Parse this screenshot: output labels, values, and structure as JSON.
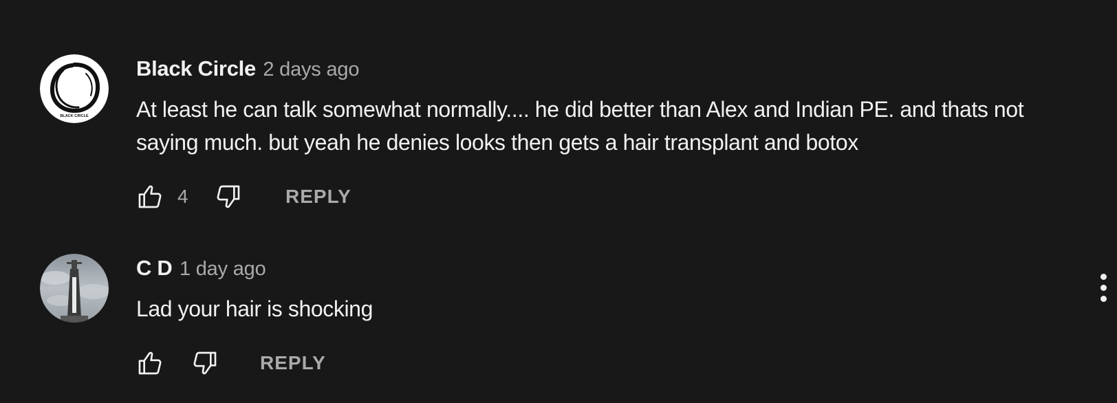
{
  "comments": [
    {
      "author": "Black Circle",
      "time": "2 days ago",
      "text": "At least he can talk somewhat normally.... he did better than Alex and Indian PE. and thats not saying much. but yeah he denies looks then gets a hair transplant and botox",
      "likes": "4",
      "reply_label": "REPLY",
      "avatar_caption": "BLACK CIRCLE",
      "avatar_icon": "ink-circle-logo"
    },
    {
      "author": "C D",
      "time": "1 day ago",
      "text": "Lad your hair is shocking",
      "likes": "",
      "reply_label": "REPLY",
      "avatar_icon": "monument-photo"
    }
  ],
  "colors": {
    "background": "#181818",
    "primary_text": "#f1f1f1",
    "secondary_text": "#aaaaaa"
  },
  "icons": {
    "like": "thumbs-up-icon",
    "dislike": "thumbs-down-icon",
    "more": "vertical-ellipsis-icon"
  }
}
